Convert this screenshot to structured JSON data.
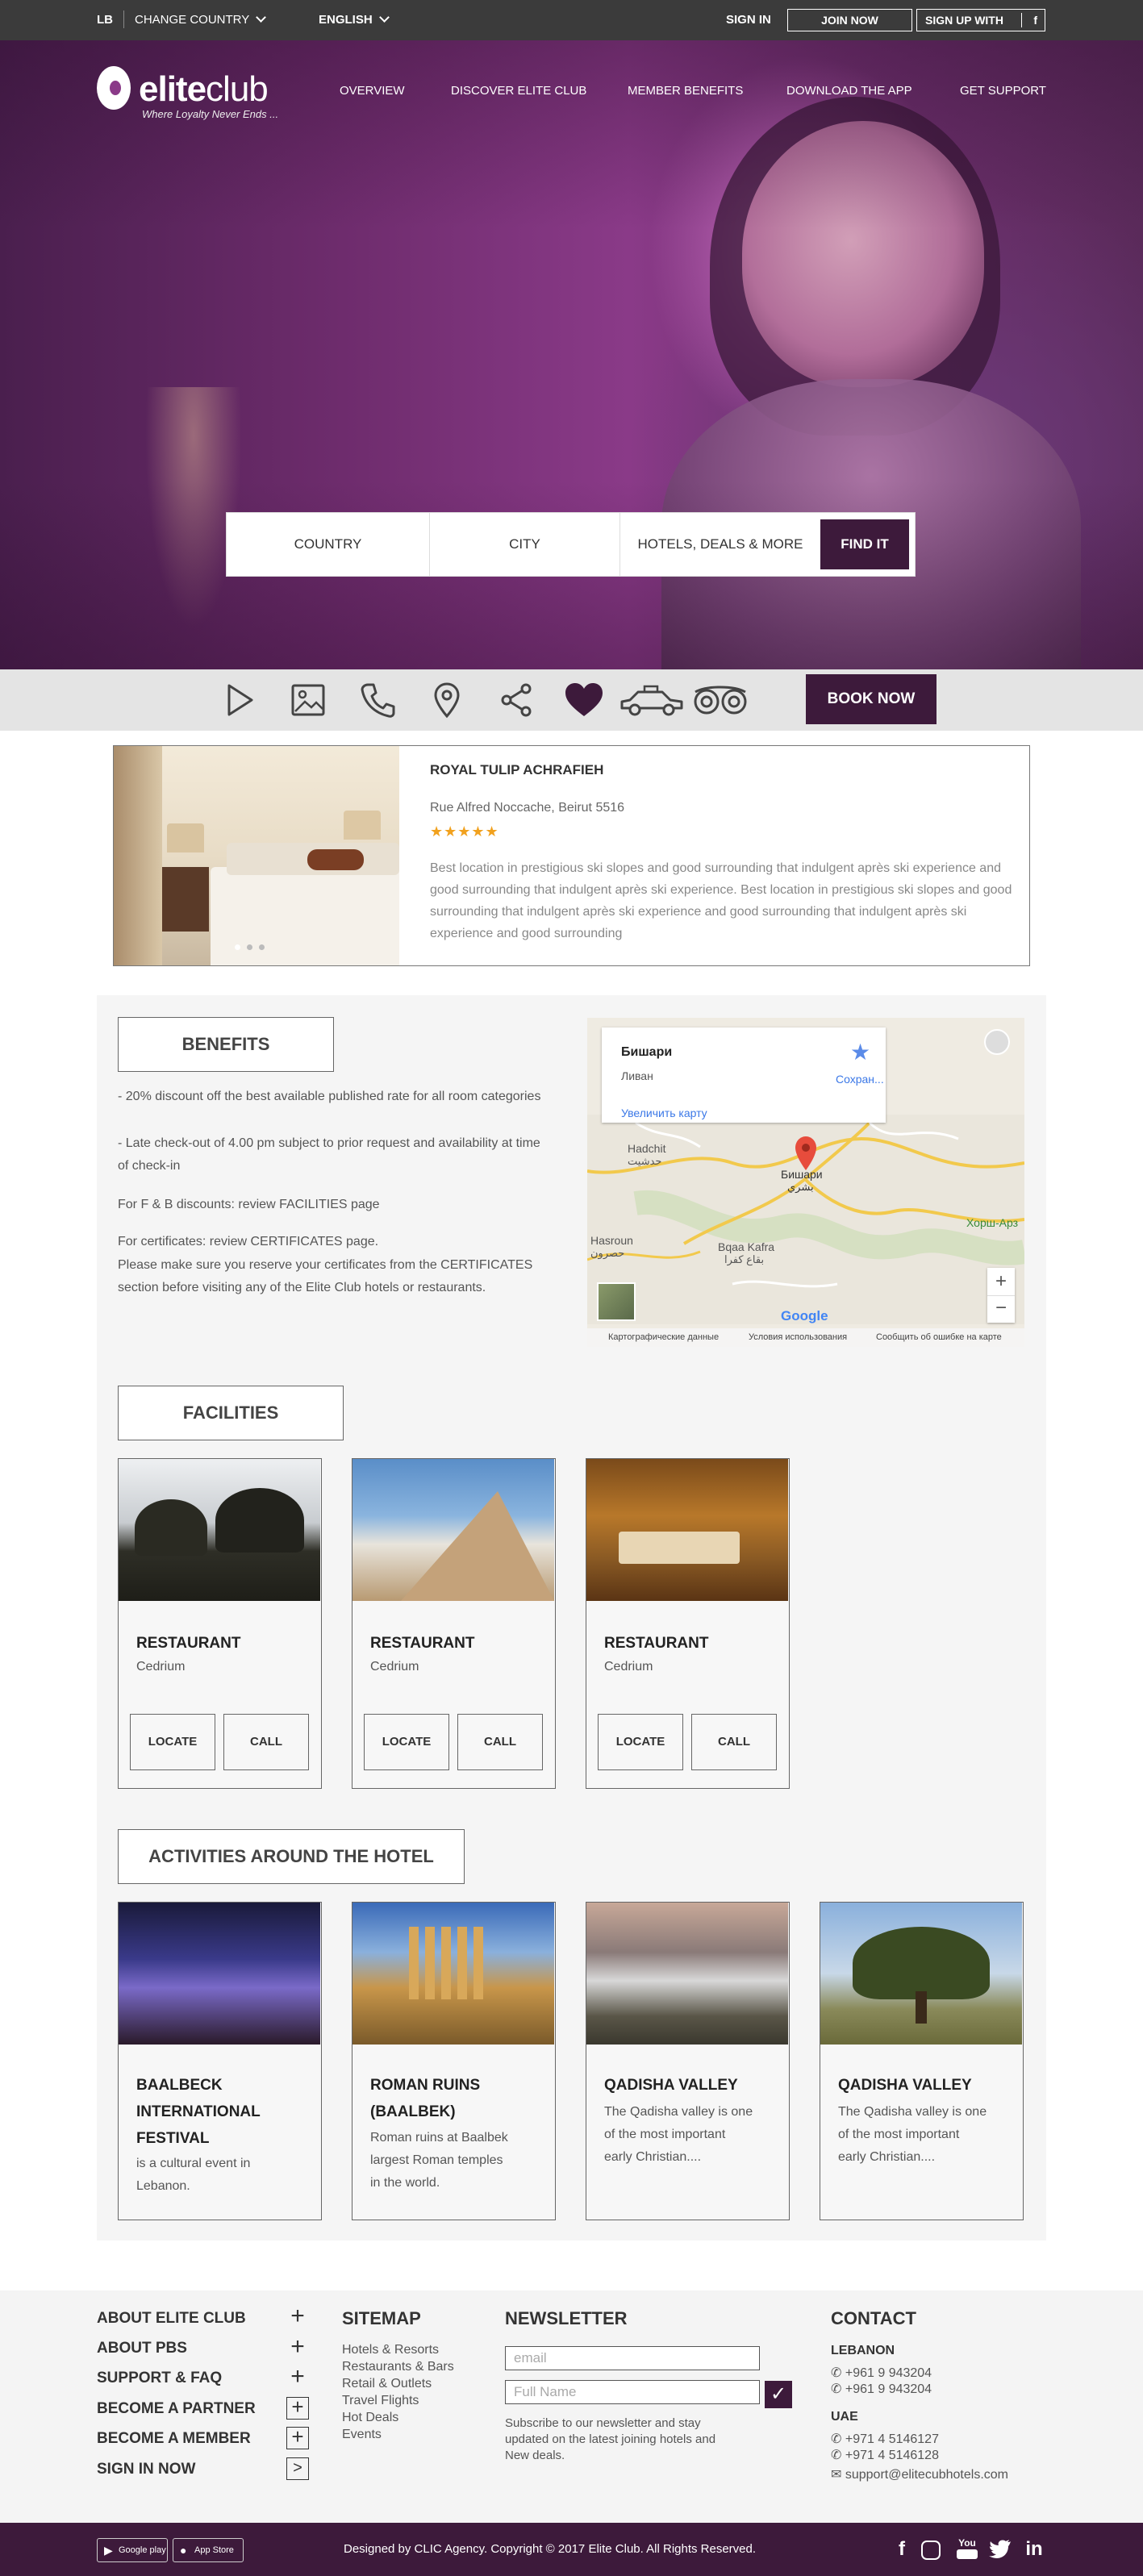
{
  "topbar": {
    "country_code": "LB",
    "change_country": "CHANGE COUNTRY",
    "language": "ENGLISH",
    "sign_in": "SIGN IN",
    "join_now": "JOIN NOW",
    "sign_up_with": "SIGN UP WITH",
    "facebook_glyph": "f"
  },
  "brand": {
    "name_bold": "elite",
    "name_light": "club",
    "tagline": "Where Loyalty Never Ends ..."
  },
  "nav": [
    "OVERVIEW",
    "DISCOVER ELITE CLUB",
    "MEMBER BENEFITS",
    "DOWNLOAD THE APP",
    "GET SUPPORT"
  ],
  "search": {
    "country": "COUNTRY",
    "city": "CITY",
    "hotels": "HOTELS, DEALS & MORE",
    "find": "FIND IT"
  },
  "iconbar": {
    "icons": [
      "play-icon",
      "gallery-icon",
      "phone-icon",
      "location-pin-icon",
      "share-icon",
      "heart-icon",
      "taxi-icon",
      "tripadvisor-icon"
    ],
    "book_now": "BOOK NOW",
    "accent": "#3d1a3b"
  },
  "hotel": {
    "name": "ROYAL TULIP ACHRAFIEH",
    "address": "Rue Alfred Noccache, Beirut 5516",
    "stars": "★★★★★",
    "description": "Best location in prestigious ski slopes and good surrounding that indulgent après ski experience and good surrounding that indulgent après ski experience. Best location in prestigious ski slopes and good surrounding that indulgent après ski experience and good surrounding that indulgent après ski experience and good surrounding"
  },
  "benefits": {
    "title": "BENEFITS",
    "line1": "- 20% discount off the best available published rate for all room categories",
    "line2": "- Late check-out of 4.00 pm subject to prior request and availability at time of check-in",
    "line3": "For F & B discounts: review FACILITIES page",
    "line4": "For certificates: review CERTIFICATES page.",
    "line5": "Please make sure you reserve your certificates from the CERTIFICATES section before visiting any of the Elite Club hotels or restaurants."
  },
  "map": {
    "place": "Бишари",
    "country": "Ливан",
    "save": "Сохран...",
    "enlarge": "Увеличить карту",
    "labels": {
      "hadchit": "Hadchit",
      "hadchit_ar": "حدشيت",
      "bsharri": "Бишари",
      "bsharri_ar": "بشري",
      "hasroun": "Hasroun",
      "hasroun_ar": "حصرون",
      "bqaa": "Bqaa Kafra",
      "bqaa_ar": "بقاع كفرا",
      "khorsh": "Хорш-Арз"
    },
    "zoom_in": "+",
    "zoom_out": "−",
    "google": "Google",
    "footer_data": "Картографические данные",
    "footer_terms": "Условия использования",
    "footer_report": "Сообщить об ошибке на карте"
  },
  "facilities": {
    "title": "FACILITIES",
    "items": [
      {
        "name": "RESTAURANT",
        "sub": "Cedrium",
        "locate": "LOCATE",
        "call": "CALL"
      },
      {
        "name": "RESTAURANT",
        "sub": "Cedrium",
        "locate": "LOCATE",
        "call": "CALL"
      },
      {
        "name": "RESTAURANT",
        "sub": "Cedrium",
        "locate": "LOCATE",
        "call": "CALL"
      }
    ]
  },
  "activities": {
    "title": "ACTIVITIES AROUND THE HOTEL",
    "items": [
      {
        "l1": "BAALBECK",
        "l2": "INTERNATIONAL",
        "l3": "FESTIVAL",
        "d1": "is a cultural event in",
        "d2": "Lebanon."
      },
      {
        "l1": "ROMAN RUINS",
        "l2": "(BAALBEK)",
        "d1": "Roman ruins at Baalbek",
        "d2": "largest Roman temples",
        "d3": "in the world."
      },
      {
        "l1": "QADISHA VALLEY",
        "d1": "The Qadisha valley is one",
        "d2": "of the most important",
        "d3": "early Christian...."
      },
      {
        "l1": "QADISHA VALLEY",
        "d1": "The Qadisha valley is one",
        "d2": "of the most important",
        "d3": "early Christian...."
      }
    ]
  },
  "footer": {
    "links": [
      "ABOUT ELITE CLUB",
      "ABOUT PBS",
      "SUPPORT & FAQ",
      "BECOME A PARTNER",
      "BECOME A MEMBER",
      "SIGN IN NOW"
    ],
    "sitemap_title": "SITEMAP",
    "sitemap": [
      "Hotels & Resorts",
      "Restaurants & Bars",
      "Retail & Outlets",
      "Travel Flights",
      "Hot Deals",
      "Events"
    ],
    "newsletter_title": "NEWSLETTER",
    "email_placeholder": "email",
    "name_placeholder": "Full Name",
    "newsletter_note1": "Subscribe to our newsletter and stay",
    "newsletter_note2": "updated on the latest joining hotels and",
    "newsletter_note3": "New deals.",
    "contact_title": "CONTACT",
    "lebanon": "LEBANON",
    "lb_phone1": "+961 9 943204",
    "lb_phone2": "+961 9 943204",
    "uae": "UAE",
    "uae_phone1": "+971 4 5146127",
    "uae_phone2": "+971 4 5146128",
    "email": "support@elitecubhotels.com"
  },
  "bottom": {
    "google_play": "Google play",
    "app_store": "App Store",
    "copyright": "Designed by CLIC Agency. Copyright © 2017 Elite Club. All Rights Reserved.",
    "social": [
      "f",
      "ig",
      "You",
      "tw",
      "in"
    ]
  }
}
